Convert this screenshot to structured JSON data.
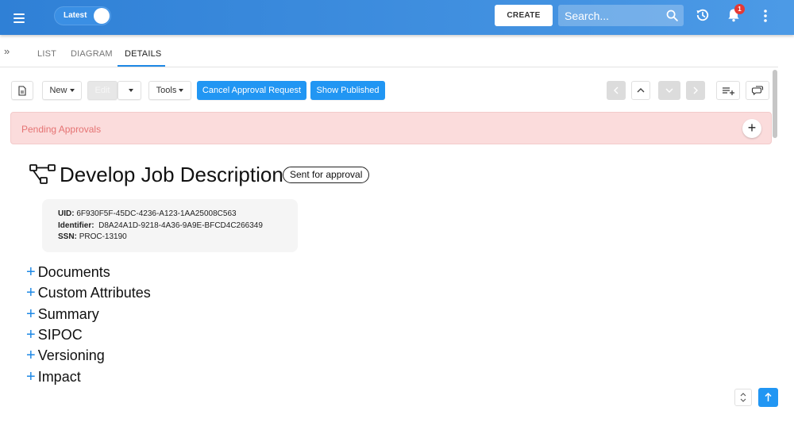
{
  "header": {
    "version_toggle_label": "Latest",
    "create_label": "CREATE",
    "search_placeholder": "Search...",
    "notification_count": "1"
  },
  "tabs": [
    {
      "label": "LIST",
      "active": false
    },
    {
      "label": "DIAGRAM",
      "active": false
    },
    {
      "label": "DETAILS",
      "active": true
    }
  ],
  "toolbar": {
    "new_label": "New",
    "edit_label": "Edit",
    "tools_label": "Tools",
    "cancel_approval_label": "Cancel Approval Request",
    "show_published_label": "Show Published"
  },
  "pending": {
    "label": "Pending Approvals"
  },
  "process": {
    "title": "Develop Job Description",
    "status": "Sent for approval",
    "uid_label": "UID:",
    "uid": "6F930F5F-45DC-4236-A123-1AA25008C563",
    "identifier_label": "Identifier:",
    "identifier": "D8A24A1D-9218-4A36-9A9E-BFCD4C266349",
    "ssn_label": "SSN:",
    "ssn": "PROC-13190"
  },
  "sections": [
    "Documents",
    "Custom Attributes",
    "Summary",
    "SIPOC",
    "Versioning",
    "Impact"
  ],
  "colors": {
    "header_blue": "#2f80d6",
    "primary_button": "#2196f3",
    "pending_bg": "#fbdcdc",
    "pending_text": "#e57373",
    "badge_red": "#e53935"
  },
  "icons": {
    "menu": "hamburger-icon",
    "search": "search-icon",
    "history": "history-icon",
    "notifications": "bell-icon",
    "more": "kebab-icon",
    "process": "process-flow-icon"
  }
}
